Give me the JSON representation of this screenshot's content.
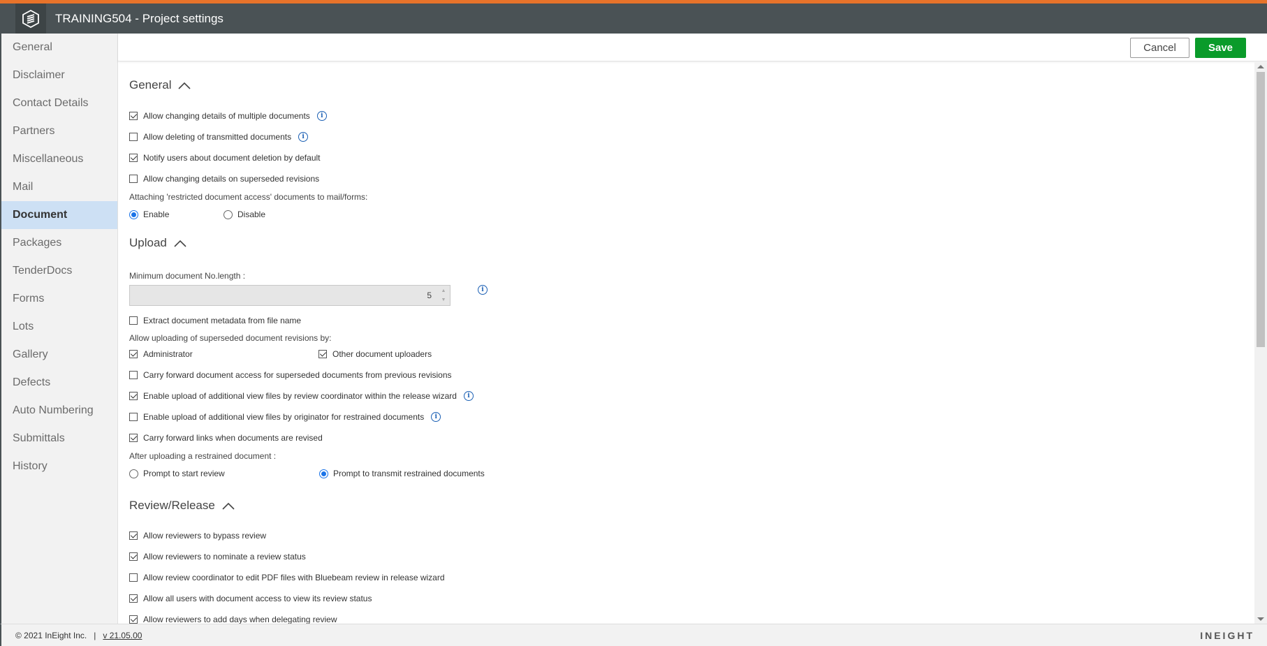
{
  "header": {
    "title": "TRAINING504 - Project settings"
  },
  "sidebar": {
    "items": [
      {
        "label": "General"
      },
      {
        "label": "Disclaimer"
      },
      {
        "label": "Contact Details"
      },
      {
        "label": "Partners"
      },
      {
        "label": "Miscellaneous"
      },
      {
        "label": "Mail"
      },
      {
        "label": "Document",
        "active": true
      },
      {
        "label": "Packages"
      },
      {
        "label": "TenderDocs"
      },
      {
        "label": "Forms"
      },
      {
        "label": "Lots"
      },
      {
        "label": "Gallery"
      },
      {
        "label": "Defects"
      },
      {
        "label": "Auto Numbering"
      },
      {
        "label": "Submittals"
      },
      {
        "label": "History"
      }
    ]
  },
  "actions": {
    "cancel_label": "Cancel",
    "save_label": "Save"
  },
  "general": {
    "title": "General",
    "opt1": "Allow changing details of multiple documents",
    "opt2": "Allow deleting of transmitted documents",
    "opt3": "Notify users about document deletion by default",
    "opt4": "Allow changing details on superseded revisions",
    "attach_label": "Attaching 'restricted document access' documents to mail/forms:",
    "enable_label": "Enable",
    "disable_label": "Disable"
  },
  "upload": {
    "title": "Upload",
    "min_len_label": "Minimum document No.length :",
    "min_len_value": "5",
    "extract": "Extract document metadata from file name",
    "allow_upload_label": "Allow uploading of superseded document revisions by:",
    "admin": "Administrator",
    "other_uploaders": "Other document uploaders",
    "carry_access": "Carry forward document access for superseded documents from previous revisions",
    "enable_view_coord": "Enable upload of additional view files by review coordinator within the release wizard",
    "enable_view_orig": "Enable upload of additional view files by originator for restrained documents",
    "carry_links": "Carry forward links when documents are revised",
    "after_upload_label": "After uploading a restrained document :",
    "prompt_review": "Prompt to start review",
    "prompt_transmit": "Prompt to transmit restrained documents"
  },
  "review": {
    "title": "Review/Release",
    "bypass": "Allow reviewers to bypass review",
    "nominate": "Allow reviewers to nominate a review status",
    "bluebeam": "Allow review coordinator to edit PDF files with Bluebeam review in release wizard",
    "view_status": "Allow all users with document access to view its review status",
    "add_days": "Allow reviewers to add days when delegating review"
  },
  "footer": {
    "copyright": "© 2021 InEight Inc.",
    "separator": "|",
    "version": "v 21.05.00",
    "brand": "INEIGHT"
  }
}
